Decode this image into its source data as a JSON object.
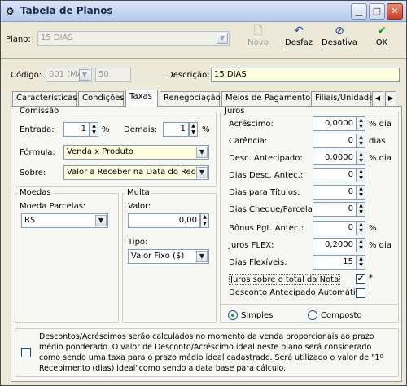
{
  "window": {
    "title": "Tabela de Planos"
  },
  "toolbar": {
    "plano_label": "Plano:",
    "plano_value": "15 DIAS",
    "novo": "Novo",
    "desfaz": "Desfaz",
    "desativa": "Desativa",
    "ok": "OK"
  },
  "header": {
    "codigo_label": "Código:",
    "codigo_value": "001 (MA",
    "codigo_num": "50",
    "descricao_label": "Descrição:",
    "descricao_value": "15 DIAS"
  },
  "tabs": [
    "Características",
    "Condições",
    "Taxas",
    "Renegociação",
    "Meios de Pagamento",
    "Filiais/Unidades"
  ],
  "comissao": {
    "title": "Comissão",
    "entrada_label": "Entrada:",
    "entrada_value": "1",
    "entrada_unit": "%",
    "demais_label": "Demais:",
    "demais_value": "1",
    "demais_unit": "%",
    "formula_label": "Fórmula:",
    "formula_value": "Venda x Produto",
    "sobre_label": "Sobre:",
    "sobre_value": "Valor a Receber na Data do Receb"
  },
  "moedas": {
    "title": "Moedas",
    "parcelas_label": "Moeda Parcelas:",
    "parcelas_value": "R$"
  },
  "multa": {
    "title": "Multa",
    "valor_label": "Valor:",
    "valor_value": "0,00",
    "tipo_label": "Tipo:",
    "tipo_value": "Valor Fixo ($)"
  },
  "juros": {
    "title": "Juros",
    "rows": [
      {
        "label": "Acréscimo:",
        "value": "0,0000",
        "unit": "% dia"
      },
      {
        "label": "Carência:",
        "value": "0",
        "unit": "dias"
      },
      {
        "label": "Desc. Antecipado:",
        "value": "0,0000",
        "unit": "% dia"
      },
      {
        "label": "Dias Desc. Antec.:",
        "value": "0",
        "unit": ""
      },
      {
        "label": "Dias para Títulos:",
        "value": "0",
        "unit": ""
      },
      {
        "label": "Dias Cheque/Parcela",
        "value": "0",
        "unit": ""
      },
      {
        "label": "Bônus Pgt. Antec.:",
        "value": "0",
        "unit": "%"
      },
      {
        "label": "Juros FLEX:",
        "value": "0,2000",
        "unit": "% dia"
      },
      {
        "label": "Dias Flexíveis:",
        "value": "15",
        "unit": ""
      }
    ],
    "juros_total_label": "Juros sobre o total da Nota",
    "juros_total_asterisk": "*",
    "desconto_auto_label": "Desconto Antecipado Automático",
    "simples_label": "Simples",
    "composto_label": "Composto"
  },
  "footer": {
    "note": "Descontos/Acréscimos serão calculados no momento da venda proporcionais ao prazo médio ponderado. O valor de Desconto/Acréscimo ideal neste plano será considerado como sendo uma taxa para o prazo médio ideal cadastrado. Será utilizado o valor de \"1º Recebimento (dias) ideal\"como sendo a data base para cálculo."
  }
}
